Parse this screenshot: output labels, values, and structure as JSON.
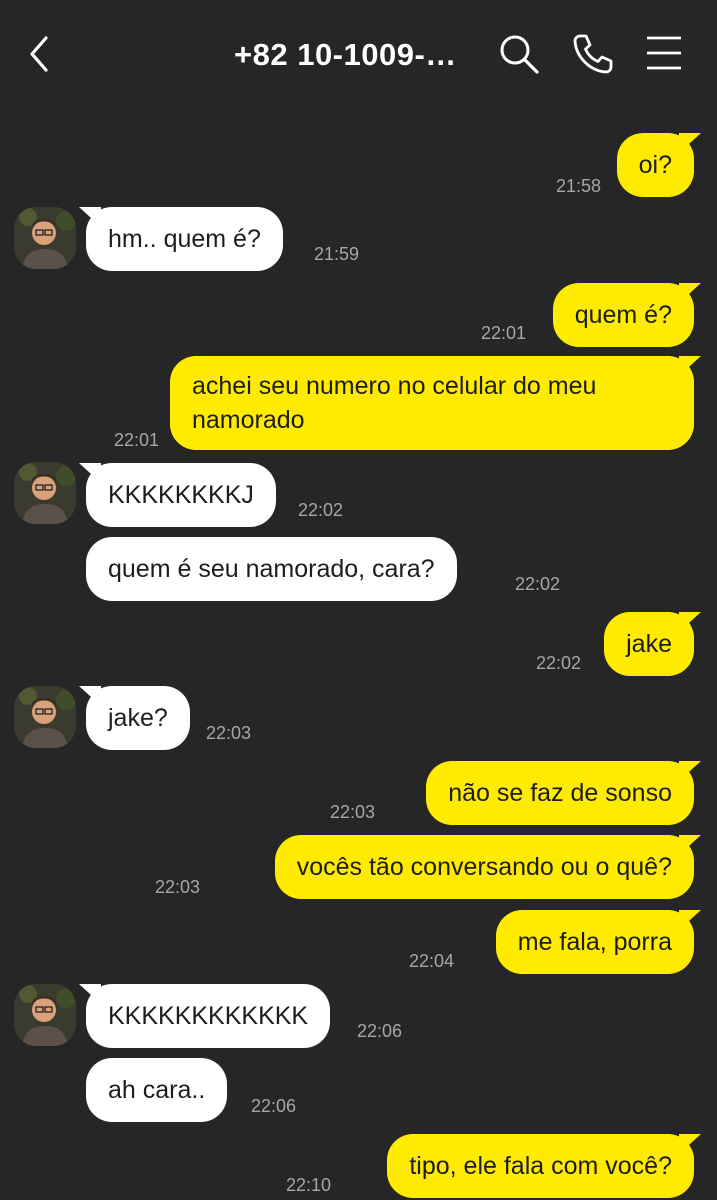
{
  "header": {
    "title": "+82 10-1009-…",
    "back_icon": "chevron-left-icon",
    "search_icon": "search-icon",
    "call_icon": "phone-icon",
    "menu_icon": "menu-icon"
  },
  "colors": {
    "background": "#262626",
    "outgoing_bubble": "#FFEB00",
    "incoming_bubble": "#ffffff",
    "timestamp": "#a6a6a6"
  },
  "messages": [
    {
      "from": "me",
      "text": "oi?",
      "time": "21:58"
    },
    {
      "from": "them",
      "text": "hm.. quem é?",
      "time": "21:59"
    },
    {
      "from": "me",
      "text": "quem é?",
      "time": "22:01"
    },
    {
      "from": "me",
      "text": "achei seu numero no celular do meu namorado",
      "time": "22:01"
    },
    {
      "from": "them",
      "text": "KKKKKKKKJ",
      "time": "22:02"
    },
    {
      "from": "them",
      "text": "quem é seu namorado, cara?",
      "time": "22:02"
    },
    {
      "from": "me",
      "text": "jake",
      "time": "22:02"
    },
    {
      "from": "them",
      "text": "jake?",
      "time": "22:03"
    },
    {
      "from": "me",
      "text": "não se faz de sonso",
      "time": "22:03"
    },
    {
      "from": "me",
      "text": "vocês tão conversando ou o quê?",
      "time": "22:03"
    },
    {
      "from": "me",
      "text": "me fala, porra",
      "time": "22:04"
    },
    {
      "from": "them",
      "text": "KKKKKKKKKKKK",
      "time": "22:06"
    },
    {
      "from": "them",
      "text": "ah cara..",
      "time": "22:06"
    },
    {
      "from": "me",
      "text": "tipo, ele fala com você?",
      "time": "22:10"
    }
  ]
}
